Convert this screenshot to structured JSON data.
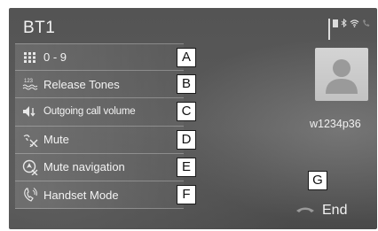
{
  "header": {
    "title": "BT1"
  },
  "status_icons": [
    "signal-strength-icon",
    "battery-icon",
    "bluetooth-icon",
    "wifi-icon",
    "call-status-icon"
  ],
  "menu": {
    "items": [
      {
        "label": "0 - 9",
        "icon": "keypad-icon",
        "callout": "A"
      },
      {
        "label": "Release Tones",
        "icon": "release-tones-icon",
        "callout": "B"
      },
      {
        "label": "Outgoing call volume",
        "icon": "volume-icon",
        "callout": "C"
      },
      {
        "label": "Mute",
        "icon": "mute-icon",
        "callout": "D"
      },
      {
        "label": "Mute navigation",
        "icon": "mute-navigation-icon",
        "callout": "E"
      },
      {
        "label": "Handset Mode",
        "icon": "handset-icon",
        "callout": "F"
      }
    ]
  },
  "contact": {
    "name": "w1234p36",
    "icon": "contact-avatar-icon"
  },
  "end_call": {
    "label": "End",
    "icon": "hang-up-icon",
    "callout": "G"
  },
  "colors": {
    "screen_bg": "#555555",
    "text": "#f2f2f2",
    "avatar": "#cccccc"
  }
}
